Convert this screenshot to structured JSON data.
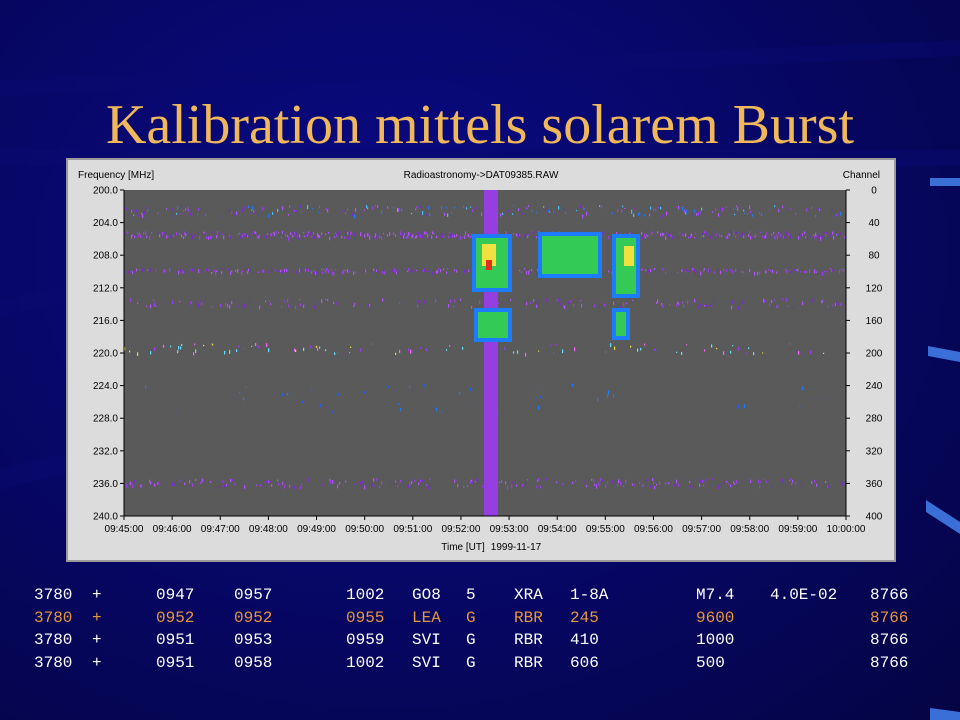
{
  "slide": {
    "title": "Kalibration mittels solarem Burst"
  },
  "spectrogram": {
    "header_left": "Frequency [MHz]",
    "header_center": "Radioastronomy->DAT09385.RAW",
    "header_right": "Channel",
    "freq_ticks": [
      "200.0",
      "204.0",
      "208.0",
      "212.0",
      "216.0",
      "220.0",
      "224.0",
      "228.0",
      "232.0",
      "236.0",
      "240.0"
    ],
    "channel_ticks": [
      "0",
      "40",
      "80",
      "120",
      "160",
      "200",
      "240",
      "280",
      "320",
      "360",
      "400"
    ],
    "time_ticks": [
      "09:45:00",
      "09:46:00",
      "09:47:00",
      "09:48:00",
      "09:49:00",
      "09:50:00",
      "09:51:00",
      "09:52:00",
      "09:53:00",
      "09:54:00",
      "09:55:00",
      "09:56:00",
      "09:57:00",
      "09:58:00",
      "09:59:00",
      "10:00:00"
    ],
    "footer_label": "Time [UT]",
    "footer_date": "1999-11-17",
    "colors": {
      "background": "#5a5a5a",
      "trace_purple": "#9b3cf0",
      "burst_blue": "#1c7cff",
      "burst_green": "#38d838",
      "burst_yellow": "#f0e040",
      "burst_red": "#e03020"
    }
  },
  "events": [
    {
      "cells": [
        "3780",
        "+",
        "0947",
        "0957",
        "1002",
        "GO8",
        "5",
        "XRA",
        "1-8A",
        "M7.4",
        "4.0E-02",
        "8766"
      ],
      "color": "#ffffff"
    },
    {
      "cells": [
        "3780",
        "+",
        "0952",
        "0952",
        "0955",
        "LEA",
        "G",
        "RBR",
        "245",
        "9600",
        "",
        "8766"
      ],
      "color": "#e8963a"
    },
    {
      "cells": [
        "3780",
        "+",
        "0951",
        "0953",
        "0959",
        "SVI",
        "G",
        "RBR",
        "410",
        "1000",
        "",
        "8766"
      ],
      "color": "#ffffff"
    },
    {
      "cells": [
        "3780",
        "+",
        "0951",
        "0958",
        "1002",
        "SVI",
        "G",
        "RBR",
        "606",
        "500",
        "",
        "8766"
      ],
      "color": "#ffffff"
    }
  ]
}
